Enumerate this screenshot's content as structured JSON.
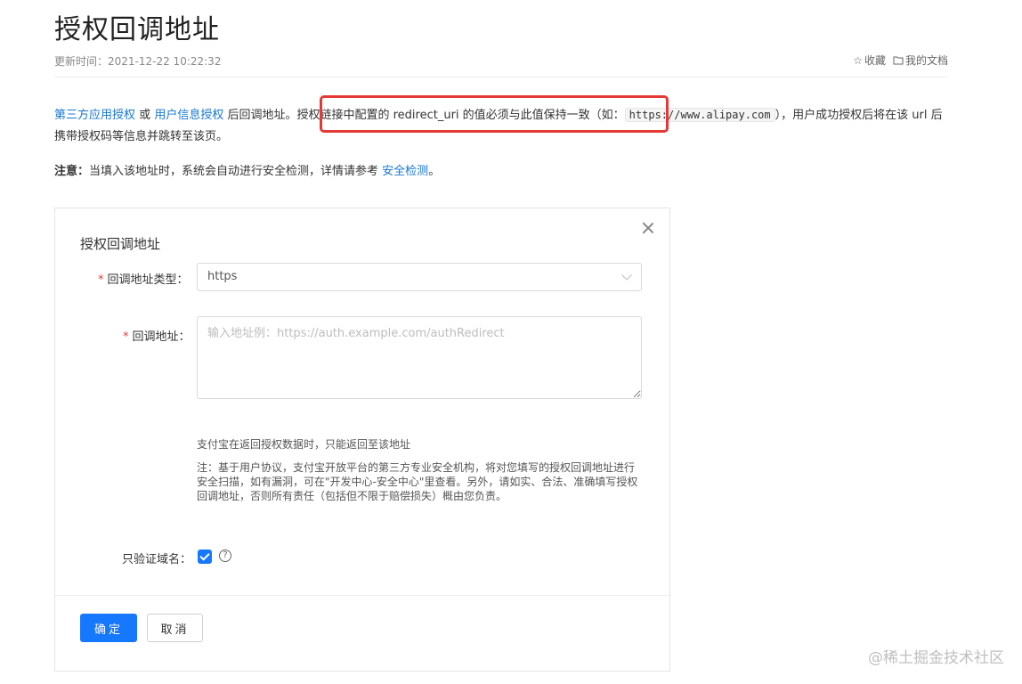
{
  "page": {
    "title": "授权回调地址",
    "updated": "更新时间：2021-12-22 10:22:32",
    "actions": {
      "favorite": "收藏",
      "my_docs": "我的文档"
    }
  },
  "intro": {
    "link1": "第三方应用授权",
    "or": "或",
    "link2": "用户信息授权",
    "text1": "后回调地址。",
    "text2": "授权链接中配置的 redirect_uri 的值必须与此值保持一致（如：",
    "example_url": "https://www.alipay.com",
    "text3": "），用户成功授权后将在该 url 后携带授权码等信息并跳转至该页。"
  },
  "note": {
    "label": "注意：",
    "text": "当填入该地址时，系统会自动进行安全检测，详情请参考",
    "link": "安全检测",
    "end": "。"
  },
  "dialog": {
    "title": "授权回调地址",
    "type_label": "回调地址类型：",
    "type_value": "https",
    "address_label": "回调地址：",
    "address_placeholder": "输入地址例：https://auth.example.com/authRedirect",
    "address_value": "",
    "help1": "支付宝在返回授权数据时，只能返回至该地址",
    "help2": "注：基于用户协议，支付宝开放平台的第三方专业安全机构，将对您填写的授权回调地址进行安全扫描，如有漏洞，可在\"开发中心-安全中心\"里查看。另外，请如实、合法、准确填写授权回调地址，否则所有责任（包括但不限于赔偿损失）概由您负责。",
    "domain_only_label": "只验证域名：",
    "domain_only_checked": true,
    "help_glyph": "?",
    "confirm": "确定",
    "cancel": "取消"
  },
  "watermark": "@稀土掘金技术社区",
  "colors": {
    "link": "#1677d2",
    "primary": "#1677ff",
    "highlight_box": "#e53935",
    "required": "#e53935"
  },
  "icons": {
    "favorite": "star-outline-icon",
    "my_docs": "folder-outline-icon",
    "close": "close-icon",
    "select_arrow": "chevron-down-icon",
    "help": "question-circle-icon",
    "check": "check-icon"
  }
}
